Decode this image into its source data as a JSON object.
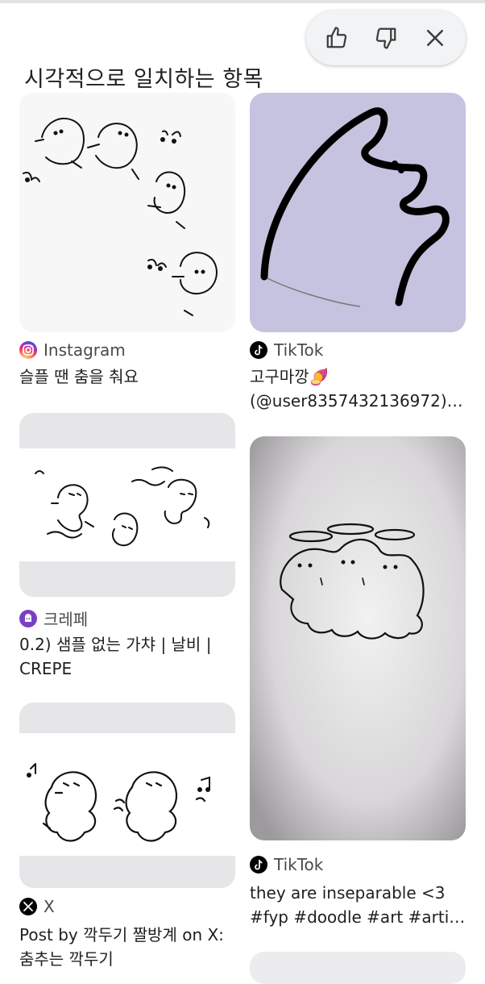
{
  "section_title": "시각적으로 일치하는 항목",
  "feedback": {
    "like_icon": "thumbs-up-icon",
    "dislike_icon": "thumbs-down-icon",
    "close_icon": "close-icon"
  },
  "results": [
    {
      "source": "Instagram",
      "source_icon": "instagram-icon",
      "caption_lines": [
        "슬플 땐 춤을 춰요"
      ]
    },
    {
      "source": "TikTok",
      "source_icon": "tiktok-icon",
      "caption_lines": [
        "고구마깡🍠",
        "(@user8357432136972) …"
      ]
    },
    {
      "source": "크레페",
      "source_icon": "crepe-icon",
      "caption_lines": [
        "0.2) 샘플 없는 가챠 | 날비 |",
        "CREPE"
      ]
    },
    {
      "source": "TikTok",
      "source_icon": "tiktok-icon",
      "caption_lines": [
        "they are inseparable <3",
        "#fyp #doodle #art #artis…"
      ]
    },
    {
      "source": "X",
      "source_icon": "x-icon",
      "caption_lines": [
        "Post by 깍두기 짤방계 on X:",
        "춤추는 깍두기"
      ]
    }
  ],
  "colors": {
    "instagram": "#d6249f",
    "tiktok": "#000000",
    "crepe": "#7b3fc4",
    "x": "#000000",
    "thumb_lavender": "#c5c3df"
  }
}
